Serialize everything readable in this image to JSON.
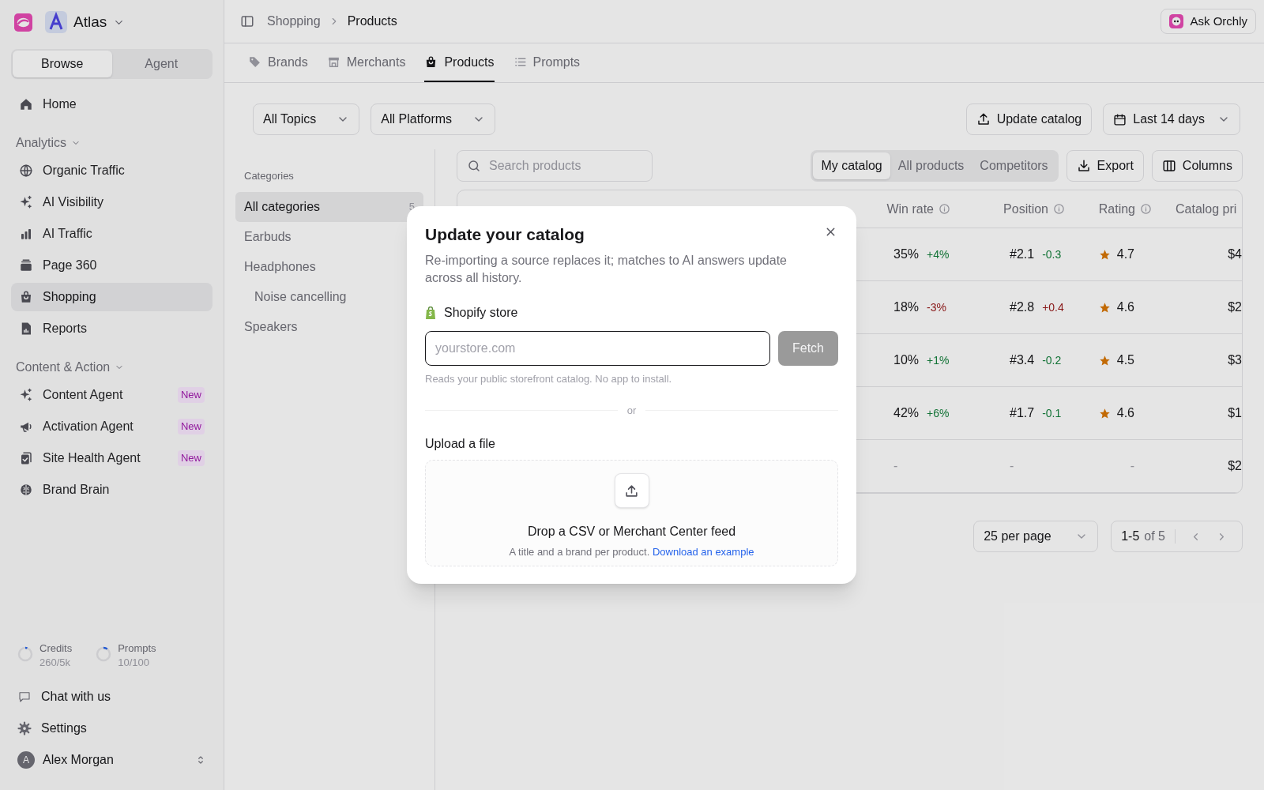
{
  "workspace": {
    "name": "Atlas"
  },
  "mode_switch": [
    {
      "label": "Browse",
      "selected": true
    },
    {
      "label": "Agent",
      "selected": false
    }
  ],
  "sidebar": {
    "items": [
      {
        "kind": "item",
        "label": "Home",
        "selected": false
      },
      {
        "kind": "section",
        "label": "Analytics"
      },
      {
        "kind": "item",
        "label": "Organic Traffic",
        "selected": false
      },
      {
        "kind": "item",
        "label": "AI Visibility",
        "selected": false
      },
      {
        "kind": "item",
        "label": "AI Traffic",
        "selected": false
      },
      {
        "kind": "item",
        "label": "Page 360",
        "selected": false
      },
      {
        "kind": "item",
        "label": "Shopping",
        "selected": true
      },
      {
        "kind": "item",
        "label": "Reports",
        "selected": false
      },
      {
        "kind": "section",
        "label": "Content & Action"
      },
      {
        "kind": "item",
        "label": "Content Agent",
        "selected": false,
        "badge": "New"
      },
      {
        "kind": "item",
        "label": "Activation Agent",
        "selected": false,
        "badge": "New"
      },
      {
        "kind": "item",
        "label": "Site Health Agent",
        "selected": false,
        "badge": "New"
      },
      {
        "kind": "item",
        "label": "Brand Brain",
        "selected": false
      }
    ],
    "usage": [
      {
        "label": "Credits",
        "value": "260/5k",
        "level": 0.05
      },
      {
        "label": "Prompts",
        "value": "10/100",
        "level": 0.1
      }
    ],
    "footer_items": [
      "Chat with us",
      "Settings"
    ],
    "user": {
      "initial": "A",
      "name": "Alex Morgan"
    }
  },
  "breadcrumb": [
    "Shopping",
    "Products"
  ],
  "ask_button": "Ask Orchly",
  "tabs": [
    {
      "label": "Brands",
      "selected": false
    },
    {
      "label": "Merchants",
      "selected": false
    },
    {
      "label": "Products",
      "selected": true
    },
    {
      "label": "Prompts",
      "selected": false
    }
  ],
  "filters": [
    "All Topics",
    "All Platforms"
  ],
  "update_button": "Update catalog",
  "date_range": "Last 14 days",
  "categories": {
    "title": "Categories",
    "items": [
      {
        "label": "All categories",
        "count": "5",
        "selected": true
      },
      {
        "label": "Earbuds",
        "selected": false
      },
      {
        "label": "Headphones",
        "selected": false,
        "children": [
          {
            "label": "Noise cancelling",
            "selected": false
          }
        ]
      },
      {
        "label": "Speakers",
        "selected": false
      }
    ]
  },
  "search": {
    "placeholder": "Search products"
  },
  "view_switch": [
    {
      "label": "My catalog",
      "selected": true
    },
    {
      "label": "All products",
      "selected": false
    },
    {
      "label": "Competitors",
      "selected": false
    }
  ],
  "export_button": "Export",
  "columns_button": "Columns",
  "table": {
    "columns": [
      "Win rate",
      "Position",
      "Rating",
      "Catalog pri"
    ],
    "rows": [
      {
        "win_rate": "35%",
        "win_change": {
          "text": "+4%",
          "color": "#15803d"
        },
        "position": "#2.1",
        "position_change": {
          "text": "-0.3",
          "color": "#15803d"
        },
        "rating": {
          "value": "4.7",
          "star": true
        },
        "price": "$4"
      },
      {
        "win_rate": "18%",
        "win_change": {
          "text": "-3%",
          "color": "#991b1b"
        },
        "position": "#2.8",
        "position_change": {
          "text": "+0.4",
          "color": "#991b1b"
        },
        "rating": {
          "value": "4.6",
          "star": true
        },
        "price": "$2"
      },
      {
        "win_rate": "10%",
        "win_change": {
          "text": "+1%",
          "color": "#15803d"
        },
        "position": "#3.4",
        "position_change": {
          "text": "-0.2",
          "color": "#15803d"
        },
        "rating": {
          "value": "4.5",
          "star": true
        },
        "price": "$3"
      },
      {
        "win_rate": "42%",
        "win_change": {
          "text": "+6%",
          "color": "#15803d"
        },
        "position": "#1.7",
        "position_change": {
          "text": "-0.1",
          "color": "#15803d"
        },
        "rating": {
          "value": "4.6",
          "star": true
        },
        "price": "$1"
      },
      {
        "win_rate": "-",
        "position": "-",
        "rating": {
          "value": "-",
          "star": false
        },
        "price": "$2"
      }
    ]
  },
  "pagination": {
    "per_page": "25 per page",
    "range": "1-5",
    "total": "of 5"
  },
  "modal": {
    "title": "Update your catalog",
    "description": "Re-importing a source replaces it; matches to AI answers update across all history.",
    "source_label": "Shopify store",
    "input": {
      "placeholder": "yourstore.com"
    },
    "fetch_button": {
      "label": "Fetch",
      "disabled": true
    },
    "hint": "Reads your public storefront catalog. No app to install.",
    "divider": "or",
    "upload_label": "Upload a file",
    "dropzone": {
      "title": "Drop a CSV or Merchant Center feed",
      "text": "A title and a brand per product.",
      "link": "Download an example"
    }
  }
}
